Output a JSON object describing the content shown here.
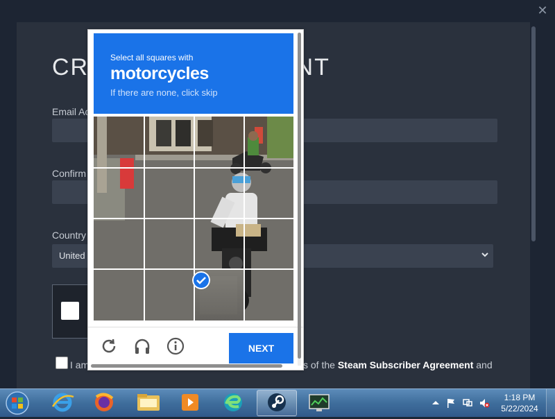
{
  "steam": {
    "title_left": "CRI",
    "title_right": "UNT",
    "email_label": "Email Ac",
    "confirm_label": "Confirm",
    "country_label": "Country",
    "country_value": "United",
    "agree_text_left": "I am",
    "agree_text_right_pre": "s of the ",
    "agree_link": "Steam Subscriber Agreement",
    "agree_text_right_post": " and",
    "close_glyph": "✕"
  },
  "captcha": {
    "instruction": "Select all squares with",
    "target": "motorcycles",
    "hint": "If there are none, click skip",
    "next_label": "NEXT",
    "selected_tiles": [
      14
    ],
    "grid_rows": 4,
    "grid_cols": 4
  },
  "taskbar": {
    "time": "1:18 PM",
    "date": "5/22/2024"
  },
  "colors": {
    "captcha_blue": "#1a73e8",
    "steam_panel": "#2a313d"
  }
}
